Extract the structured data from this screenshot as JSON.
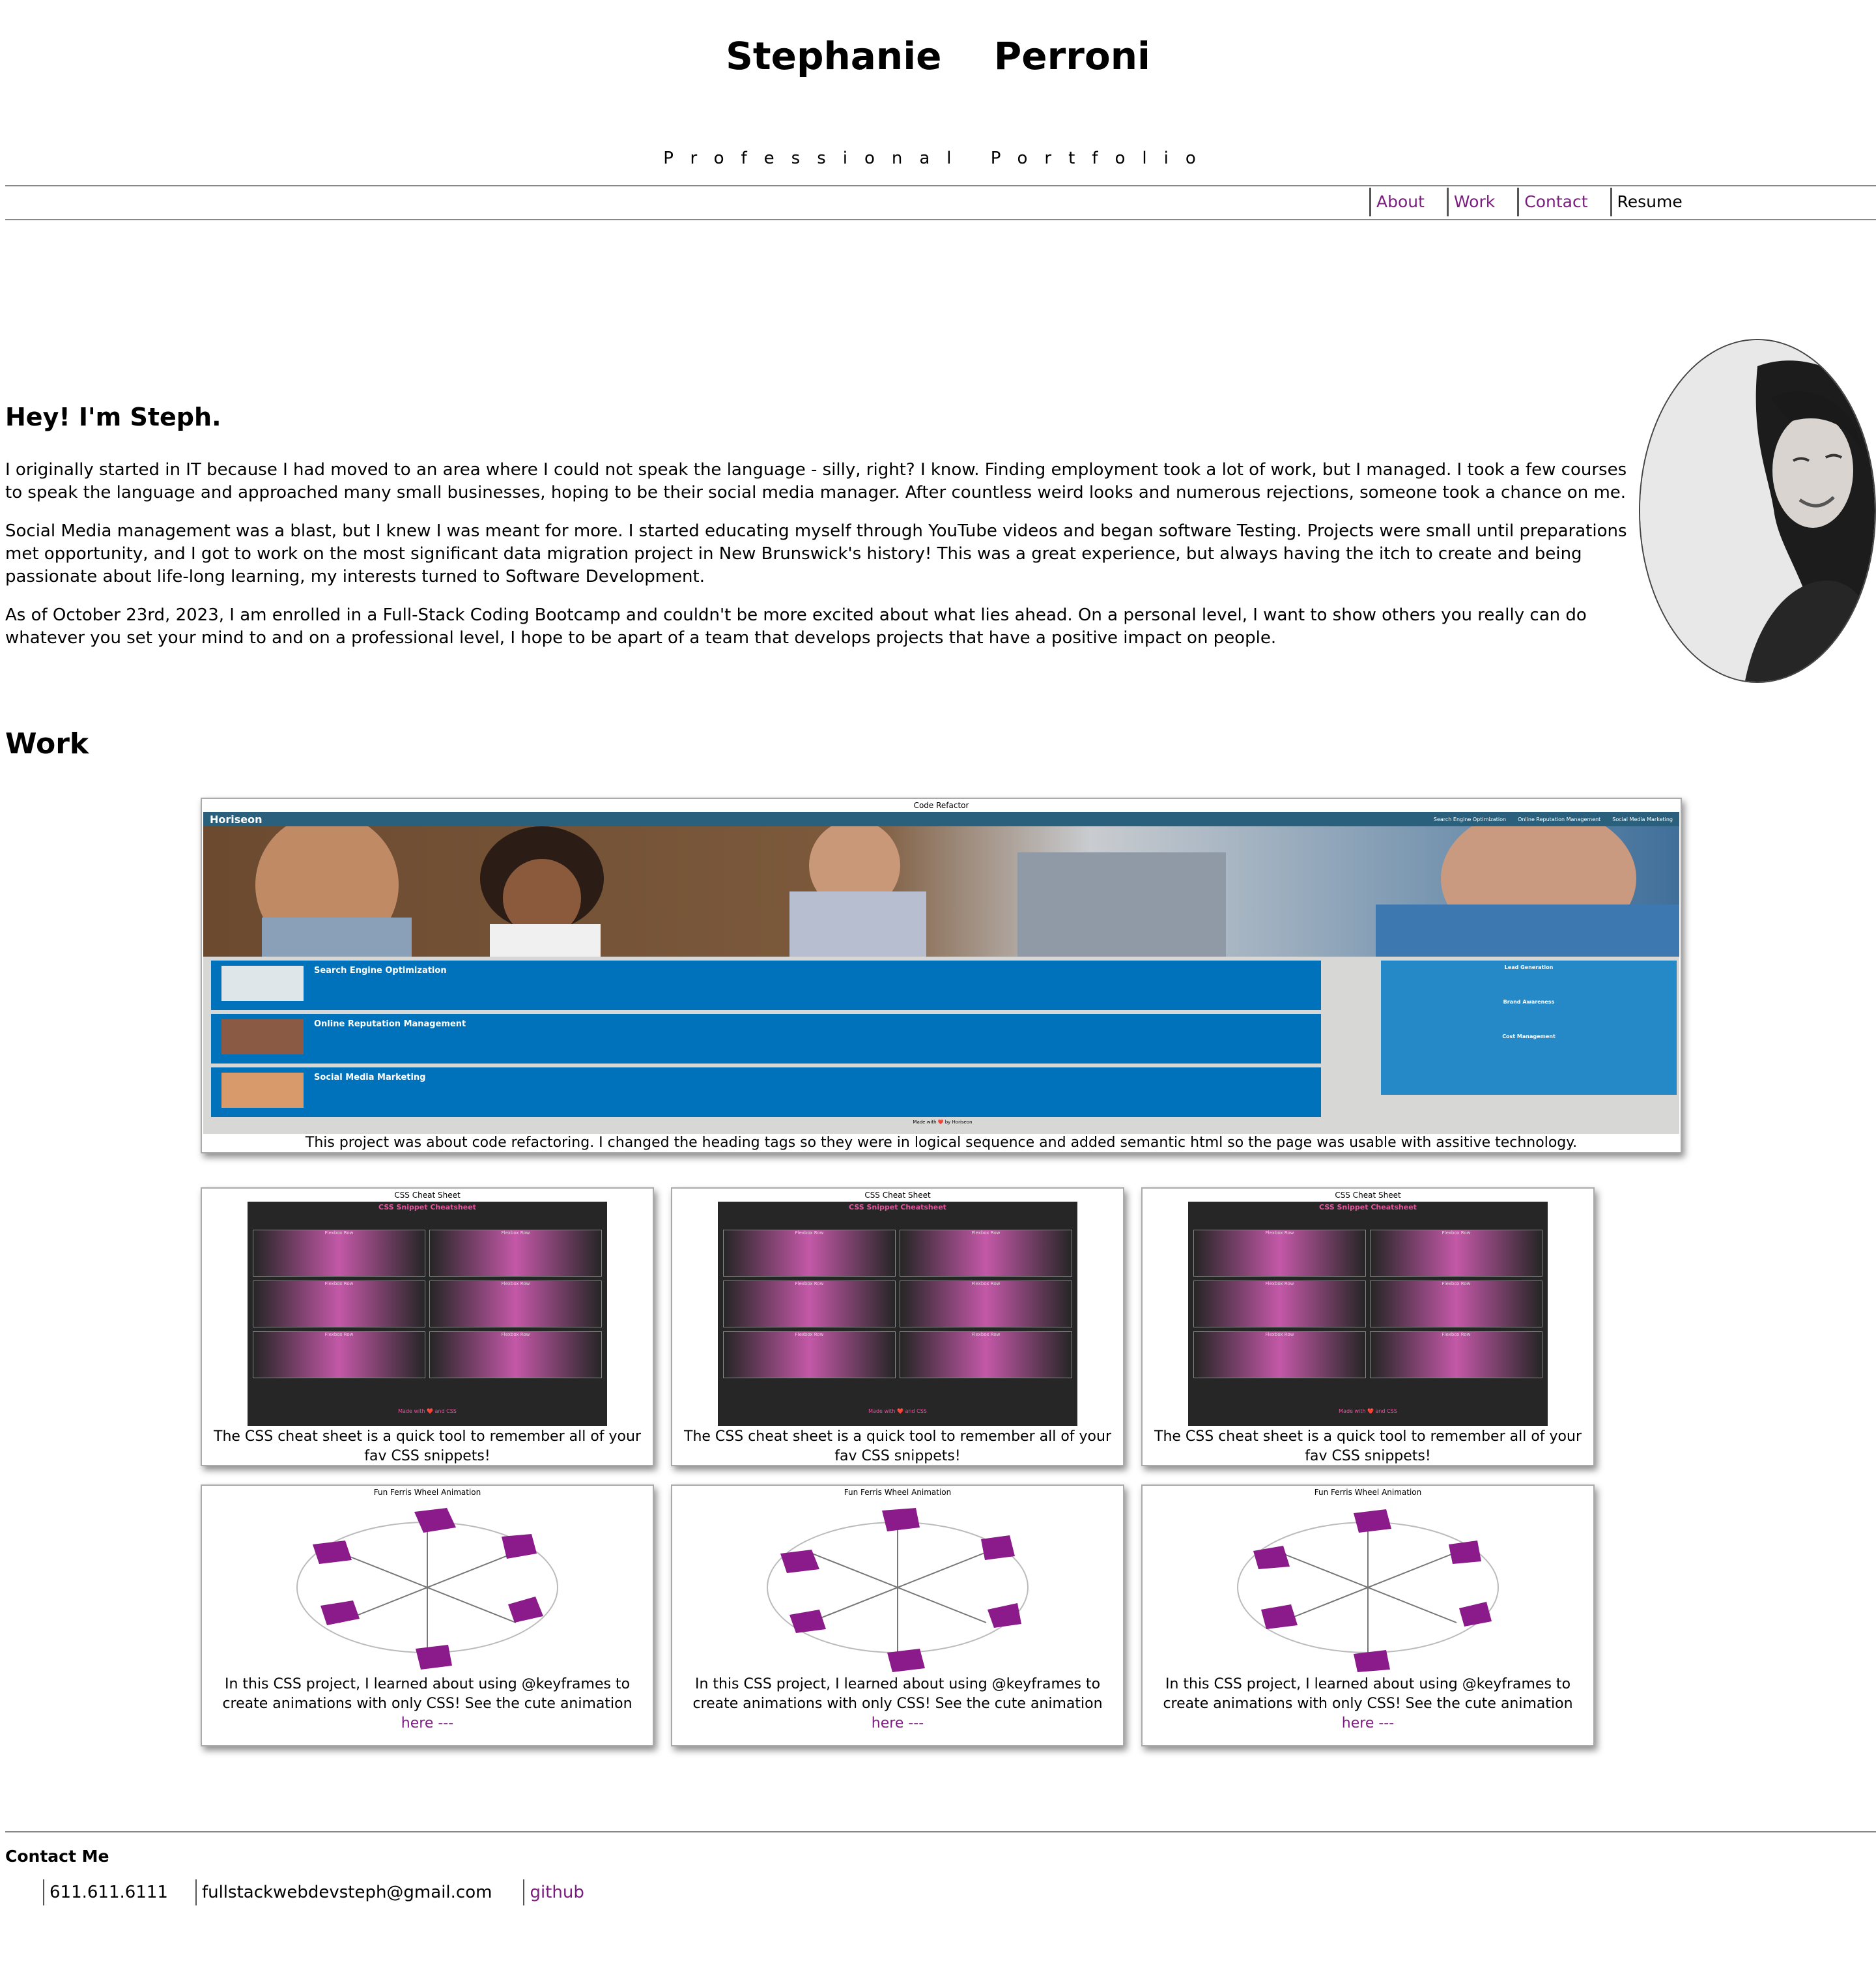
{
  "header": {
    "name": "Stephanie  Perroni",
    "subtitle": "Professional Portfolio"
  },
  "nav": {
    "about": "About",
    "work": "Work",
    "contact": "Contact",
    "resume": "Resume"
  },
  "about": {
    "heading": "Hey! I'm Steph.",
    "p1": "I originally started in IT because I had moved to an area where I could not speak the language - silly, right? I know. Finding employment took a lot of work, but I managed. I took a few courses to speak the language and approached many small businesses, hoping to be their social media manager. After countless weird looks and numerous rejections, someone took a chance on me.",
    "p2": "Social Media management was a blast, but I knew I was meant for more. I started educating myself through YouTube videos and began software Testing. Projects were small until preparations met opportunity, and I got to work on the most significant data migration project in New Brunswick's history! This was a great experience, but always having the itch to create and being passionate about life-long learning, my interests turned to Software Development.",
    "p3": "As of October 23rd, 2023, I am enrolled in a Full-Stack Coding Bootcamp and couldn't be more excited about what lies ahead. On a personal level, I want to show others you really can do whatever you set your mind to and on a professional level, I hope to be apart of a team that develops projects that have a positive impact on people."
  },
  "work": {
    "heading": "Work",
    "featured": {
      "title": "Code Refactor",
      "desc": "This project was about code refactoring. I changed the heading tags so they were in logical sequence and added semantic html so the page was usable with assitive technology.",
      "preview": {
        "brand": "Horiseon",
        "nav": [
          "Search Engine Optimization",
          "Online Reputation Management",
          "Social Media Marketing"
        ],
        "sections": [
          "Search Engine Optimization",
          "Online Reputation Management",
          "Social Media Marketing"
        ],
        "benefits": [
          "Lead Generation",
          "Brand Awareness",
          "Cost Management"
        ],
        "footer": "Made with ❤️ by Horiseon"
      }
    },
    "cheatsheet": {
      "title": "CSS Cheat Sheet",
      "desc": "The CSS cheat sheet is a quick tool to remember all of your fav CSS snippets!",
      "preview_title": "CSS Snippet Cheatsheet",
      "preview_row": "Flexbox Row",
      "preview_footer": "Made with ❤️ and CSS"
    },
    "ferris": {
      "title": "Fun Ferris Wheel Animation",
      "desc": "In this CSS project, I learned about using @keyframes to create animations with only CSS! See the cute animation",
      "link": "here ---"
    }
  },
  "contact": {
    "heading": "Contact Me",
    "phone": "611.611.6111",
    "email": "fullstackwebdevsteph@gmail.com",
    "github": "github"
  },
  "colors": {
    "accent": "#7a1d7e",
    "ferris_car": "#8b1a8b",
    "horiseon_blue": "#0072bb"
  }
}
